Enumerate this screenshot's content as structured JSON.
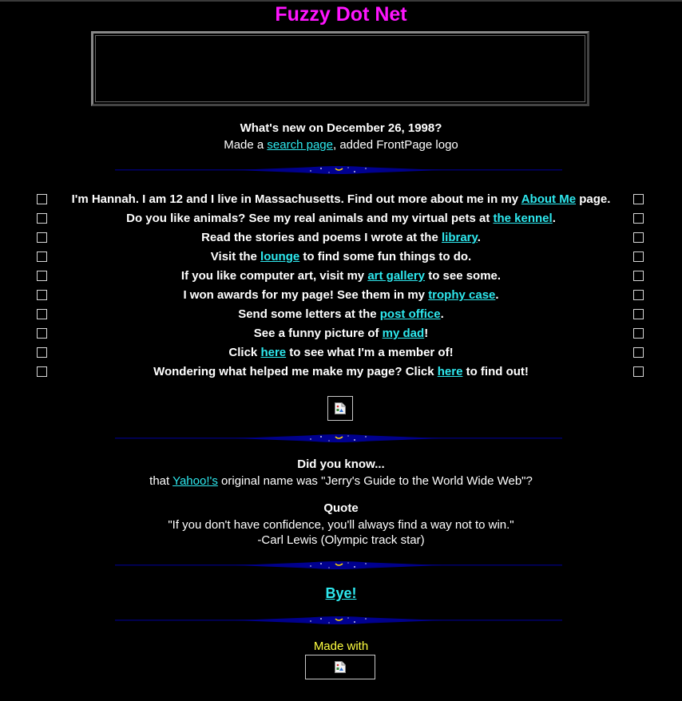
{
  "title": "Fuzzy Dot Net",
  "whats_new": {
    "heading": "What's new on December 26, 1998?",
    "pre": "Made a ",
    "link": "search page",
    "post": ", added FrontPage logo"
  },
  "menu": [
    {
      "pre": "I'm Hannah.  I am 12  and I live in Massachusetts.  Find out more about me in my ",
      "link": "About Me",
      "post": " page."
    },
    {
      "pre": "Do you like animals?  See my real animals and my virtual pets at ",
      "link": "the kennel",
      "post": "."
    },
    {
      "pre": "Read the stories and poems I wrote at the ",
      "link": "library",
      "post": "."
    },
    {
      "pre": "Visit the ",
      "link": "lounge",
      "post": " to find some fun things to do."
    },
    {
      "pre": "If you like computer art, visit my ",
      "link": "art gallery",
      "post": " to see some."
    },
    {
      "pre": "I won awards for my page!  See them in my ",
      "link": "trophy case",
      "post": "."
    },
    {
      "pre": "Send some letters at the ",
      "link": "post office",
      "post": "."
    },
    {
      "pre": "See a funny picture of ",
      "link": "my dad",
      "post": "!"
    },
    {
      "pre": "Click ",
      "link": "here",
      "post": " to see what I'm a member of!"
    },
    {
      "pre": "Wondering what helped me make my page?  Click ",
      "link": "here",
      "post": " to find out!"
    }
  ],
  "did_you_know": {
    "heading": "Did you know...",
    "pre": "that ",
    "link": "Yahoo!'s",
    "post": " original name was \"Jerry's Guide to the World Wide Web\"?"
  },
  "quote": {
    "heading": "Quote",
    "text": "\"If you don't have confidence, you'll always find a way not to win.\"",
    "author": "-Carl Lewis (Olympic track star)"
  },
  "bye": "Bye!",
  "made_with": "Made with",
  "colors": {
    "title": "#ff14ff",
    "link": "#2ee8ee",
    "made_with": "#ffff40",
    "background": "#000000"
  },
  "icons": {
    "divider": "starry-divider",
    "bullet": "checkbox-square",
    "image": "broken-image-icon"
  }
}
